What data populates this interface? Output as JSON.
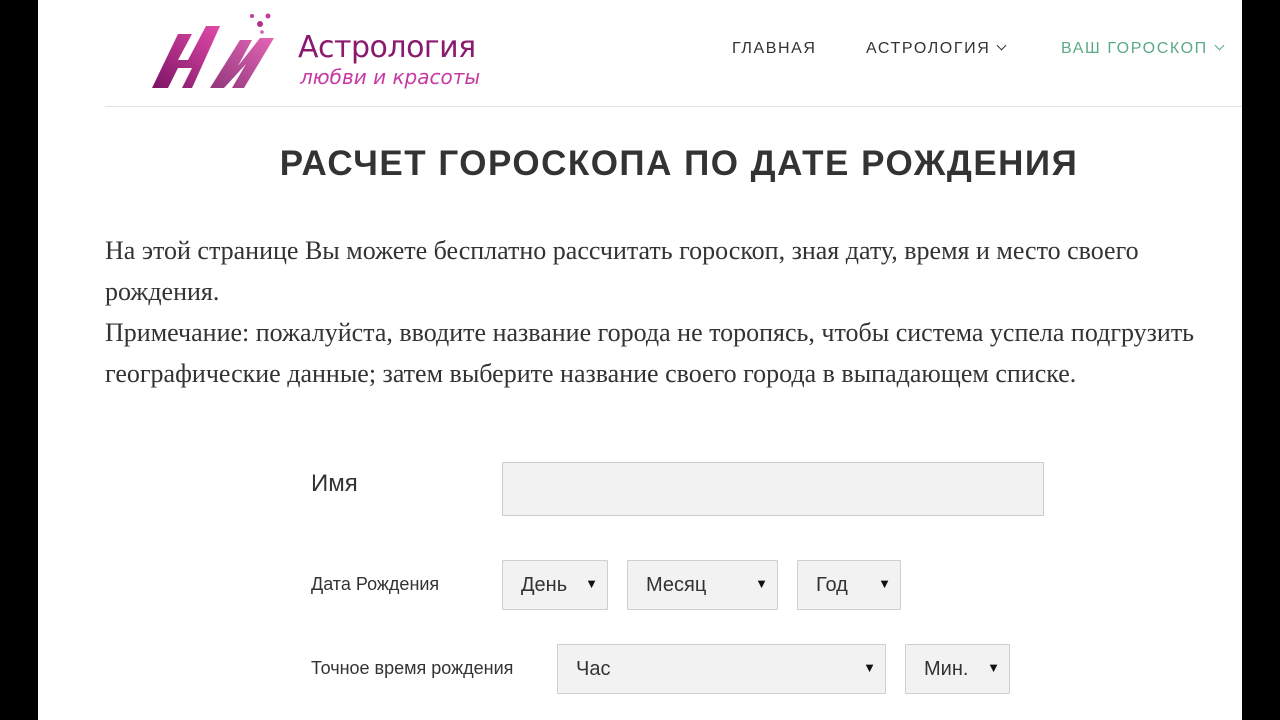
{
  "logo": {
    "title": "Астрология",
    "subtitle": "любви и красоты"
  },
  "nav": {
    "home": "ГЛАВНАЯ",
    "astrology": "АСТРОЛОГИЯ",
    "horoscope": "ВАШ ГОРОСКОП"
  },
  "page": {
    "title": "РАСЧЕТ ГОРОСКОПА ПО ДАТЕ РОЖДЕНИЯ",
    "intro_1": "На этой странице Вы можете бесплатно рассчитать гороскоп, зная дату, время и место своего рождения.",
    "intro_2": "Примечание: пожалуйста, вводите название города не торопясь, чтобы система успела подгрузить географические данные; затем выберите название своего города в выпадающем списке."
  },
  "form": {
    "name_label": "Имя",
    "name_value": "",
    "birthdate_label": "Дата Рождения",
    "day": "День",
    "month": "Месяц",
    "year": "Год",
    "birthtime_label": "Точное время рождения",
    "hour": "Час",
    "minute": "Мин."
  },
  "colors": {
    "brand": "#8a1a6e",
    "nav_active": "#5aaa85",
    "text": "#333333"
  }
}
